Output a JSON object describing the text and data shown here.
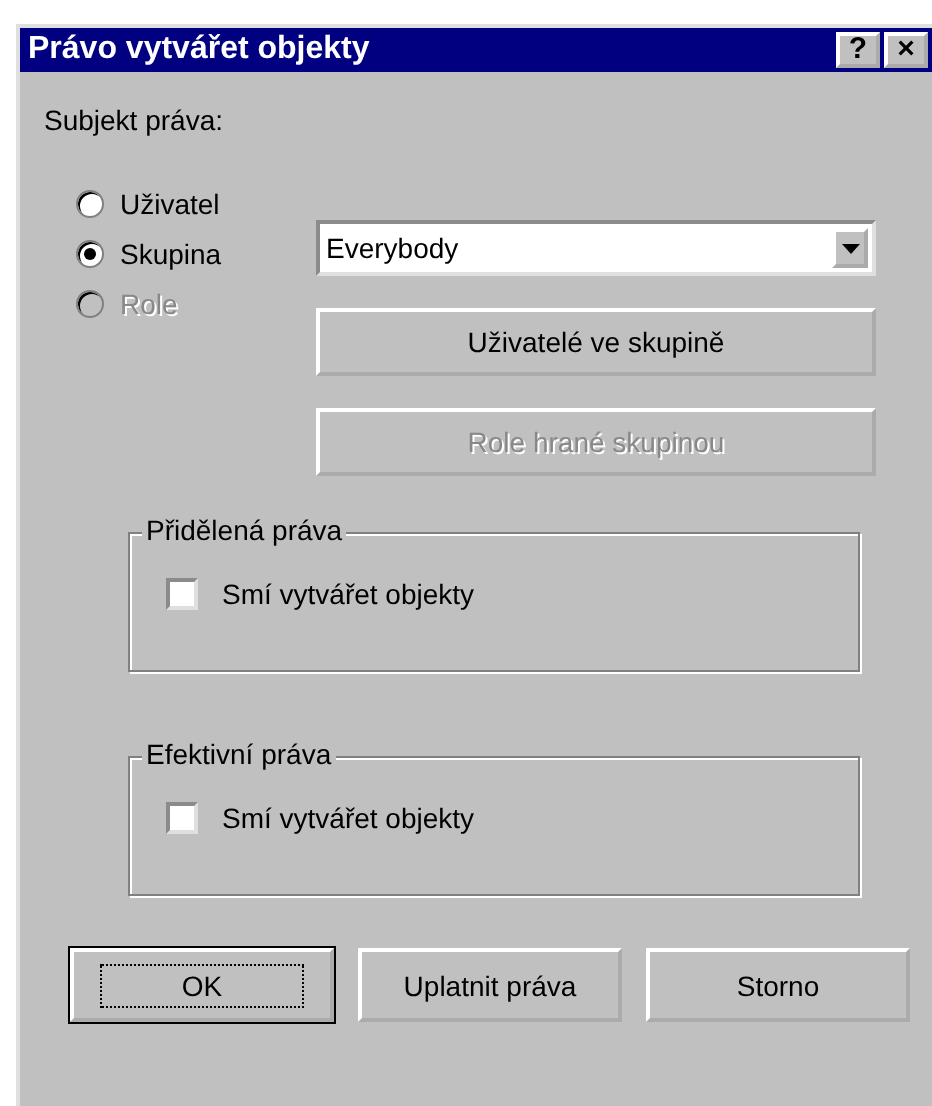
{
  "window": {
    "title": "Právo vytvářet objekty",
    "title_buttons": [
      "?",
      "×"
    ]
  },
  "subject": {
    "label": "Subjekt práva:",
    "options": [
      {
        "label": "Uživatel",
        "selected": false,
        "disabled": false
      },
      {
        "label": "Skupina",
        "selected": true,
        "disabled": false
      },
      {
        "label": "Role",
        "selected": false,
        "disabled": true
      }
    ],
    "group_select": {
      "value": "Everybody"
    },
    "buttons": [
      {
        "label": "Uživatelé ve skupině",
        "disabled": false
      },
      {
        "label": "Role hrané skupinou",
        "disabled": true
      }
    ]
  },
  "groups": [
    {
      "title": "Přidělená práva",
      "checkbox": {
        "label": "Smí vytvářet objekty",
        "checked": false
      }
    },
    {
      "title": "Efektivní práva",
      "checkbox": {
        "label": "Smí vytvářet objekty",
        "checked": false
      }
    }
  ],
  "footer_buttons": [
    {
      "label": "OK",
      "default": true
    },
    {
      "label": "Uplatnit práva",
      "default": false
    },
    {
      "label": "Storno",
      "default": false
    }
  ]
}
